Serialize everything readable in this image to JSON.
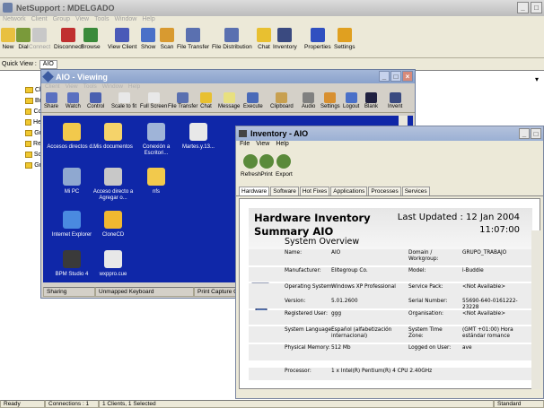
{
  "main_window": {
    "title": "NetSupport : MDELGADO",
    "menu": [
      "Network",
      "Client",
      "Group",
      "View",
      "Tools",
      "Window",
      "Help"
    ],
    "toolbar": [
      "New",
      "Dial",
      "Connect",
      "Disconnect",
      "Browse",
      "View Client",
      "Show",
      "Scan",
      "File Transfer",
      "File Distribution",
      "Chat",
      "Inventory",
      "Properties",
      "Settings"
    ],
    "quick_view_label": "Quick View :",
    "quick_view_tab": "AIO",
    "tree_items": [
      "Cl",
      "Br",
      "Cc",
      "He",
      "Gr",
      "Re",
      "Sc",
      "Gr"
    ],
    "status": [
      "Ready",
      "Connections : 1",
      "1 Clients, 1 Selected",
      "Standard"
    ]
  },
  "viewing_window": {
    "title": "AIO - Viewing",
    "menu": [
      "Client",
      "View",
      "Tools",
      "Window",
      "Help"
    ],
    "toolbar": [
      "Share",
      "Watch",
      "Control",
      "Scale to fit",
      "Full Screen",
      "File Transfer",
      "Chat",
      "Message",
      "Execute",
      "Clipboard",
      "Audio",
      "Settings",
      "Logout",
      "Blank",
      "Invent"
    ],
    "desktop_icons": [
      {
        "label": "Accesos directos d...",
        "color": "#f2c94c"
      },
      {
        "label": "Mis documentos",
        "color": "#f5d36a"
      },
      {
        "label": "Conexión a Escritori...",
        "color": "#9fb4d8"
      },
      {
        "label": "Martes.y.13...",
        "color": "#e8e8e8"
      },
      {
        "label": "Mi PC",
        "color": "#8fa8d0"
      },
      {
        "label": "Acceso directo a Agregar o...",
        "color": "#c8c8c8"
      },
      {
        "label": "nfs",
        "color": "#f2c94c"
      },
      {
        "label": "Internet Explorer",
        "color": "#4a8ae0"
      },
      {
        "label": "CloneCD",
        "color": "#f0b830"
      },
      {
        "label": "BPM Studio 4",
        "color": "#3a3a3a"
      },
      {
        "label": "wxppro.cue",
        "color": "#e8e8e8"
      }
    ],
    "status": [
      "Sharing",
      "Unmapped Keyboard",
      "Print Capture Off"
    ]
  },
  "inventory_window": {
    "title": "Inventory - AIO",
    "menu": [
      "File",
      "View",
      "Help"
    ],
    "toolbar": [
      "Refresh",
      "Print",
      "Export"
    ],
    "tabs": [
      "Hardware",
      "Software",
      "Hot Fixes",
      "Applications",
      "Processes",
      "Services"
    ],
    "report": {
      "title_line1": "Hardware Inventory",
      "title_line2": "Summary AIO",
      "updated_line1": "Last Updated : 12 Jan 2004",
      "updated_line2": "11:07:00",
      "section": "System Overview",
      "rows": [
        {
          "l1": "Name:",
          "v1": "AIO",
          "l2": "Domain / Workgroup:",
          "v2": "GRUPO_TRABAJO"
        },
        {
          "l1": "Manufacturer:",
          "v1": "Elitegroup Co.",
          "l2": "Model:",
          "v2": "i-Buddie"
        },
        {
          "l1": "Operating System:",
          "v1": "Windows XP Professional",
          "l2": "Service Pack:",
          "v2": "<Not Available>"
        },
        {
          "l1": "Version:",
          "v1": "5.01.2600",
          "l2": "Serial Number:",
          "v2": "55690-640-0161222-23228"
        },
        {
          "l1": "Registered User:",
          "v1": "ggg",
          "l2": "Organisation:",
          "v2": "<Not Available>"
        },
        {
          "l1": "System Language:",
          "v1": "Español (alfabetización internacional)",
          "l2": "System Time Zone:",
          "v2": "(GMT +01:00) Hora estándar romance"
        },
        {
          "l1": "Physical Memory:",
          "v1": "512 Mb",
          "l2": "Logged on User:",
          "v2": "ave"
        },
        {
          "l1": "Processor:",
          "v1": "1 x Intel(R) Pentium(R) 4 CPU 2.40GHz",
          "l2": "",
          "v2": ""
        }
      ]
    }
  }
}
